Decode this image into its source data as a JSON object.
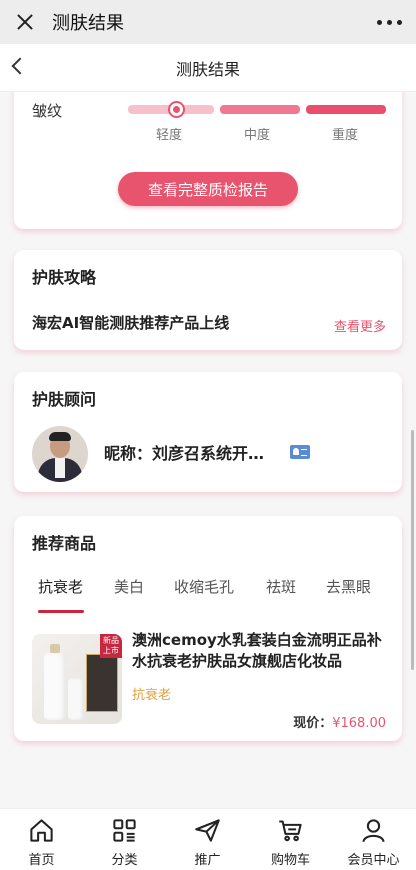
{
  "wechat": {
    "title": "测肤结果"
  },
  "nav": {
    "title": "测肤结果"
  },
  "analysis": {
    "wrinkle_label": "皱纹",
    "levels": [
      "轻度",
      "中度",
      "重度"
    ],
    "current_level": "轻度",
    "report_button": "查看完整质检报告"
  },
  "guide": {
    "heading": "护肤攻略",
    "item_text": "海宏AI智能测肤推荐产品上线",
    "more_link": "查看更多"
  },
  "advisor": {
    "heading": "护肤顾问",
    "nickname": "昵称：刘彦召系统开…"
  },
  "products": {
    "heading": "推荐商品",
    "tabs": [
      "抗衰老",
      "美白",
      "收缩毛孔",
      "祛斑",
      "去黑眼"
    ],
    "active_tab": "抗衰老",
    "item": {
      "title": "澳洲cemoy水乳套装白金流明正品补水抗衰老护肤品女旗舰店化妆品",
      "new_badge": "新品上市",
      "image_brand": "CEMOY",
      "tag": "抗衰老",
      "price_label": "现价：",
      "price": "¥168.00"
    }
  },
  "tabbar": {
    "items": [
      {
        "label": "首页",
        "icon": "home-icon"
      },
      {
        "label": "分类",
        "icon": "category-icon"
      },
      {
        "label": "推广",
        "icon": "send-icon"
      },
      {
        "label": "购物车",
        "icon": "cart-icon"
      },
      {
        "label": "会员中心",
        "icon": "user-icon"
      }
    ]
  },
  "colors": {
    "accent": "#e8546e",
    "tab_underline": "#c8283f",
    "tag": "#e0a03a"
  }
}
